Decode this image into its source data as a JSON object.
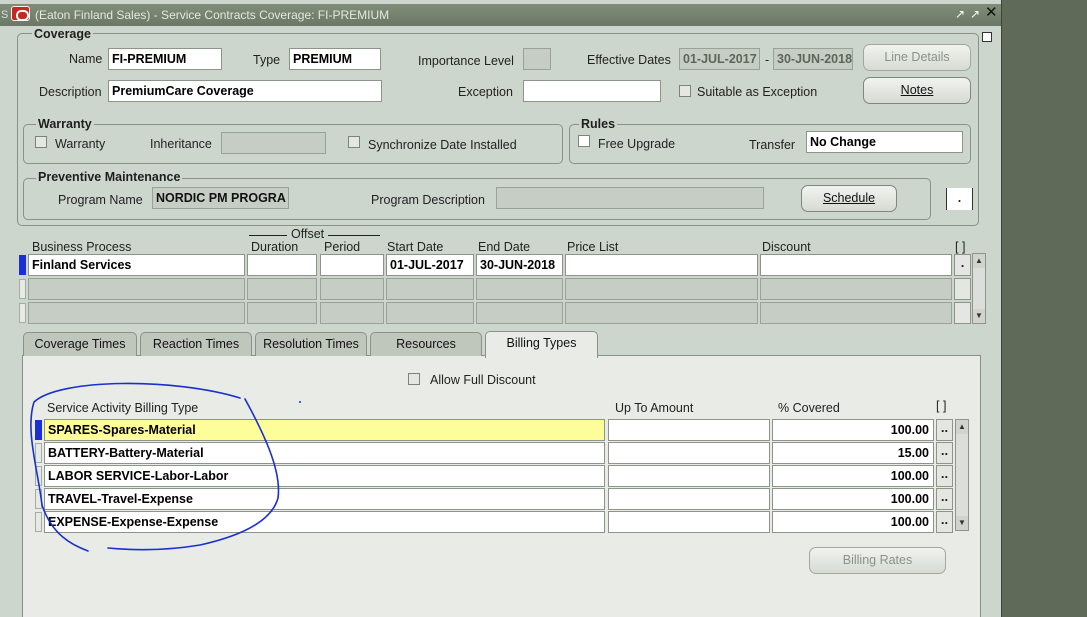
{
  "window": {
    "title": "(Eaton Finland Sales) - Service Contracts Coverage:  FI-PREMIUM",
    "left_edge_char": "S",
    "controls": [
      "↗",
      "↗",
      "✕"
    ]
  },
  "coverage": {
    "title": "Coverage",
    "name_label": "Name",
    "name_value": "FI-PREMIUM",
    "type_label": "Type",
    "type_value": "PREMIUM",
    "importance_label": "Importance Level",
    "importance_value": "",
    "effective_label": "Effective Dates",
    "effective_start": "01-JUL-2017",
    "effective_sep": "-",
    "effective_end": "30-JUN-2018",
    "line_details_label": "Line Details",
    "description_label": "Description",
    "description_value": "PremiumCare Coverage",
    "exception_label": "Exception",
    "exception_value": "",
    "suitable_label": "Suitable as Exception",
    "notes_label": "Notes"
  },
  "warranty": {
    "title": "Warranty",
    "warranty_label": "Warranty",
    "inheritance_label": "Inheritance",
    "inheritance_value": "",
    "sync_label": "Synchronize Date Installed"
  },
  "rules": {
    "title": "Rules",
    "free_upgrade_label": "Free Upgrade",
    "transfer_label": "Transfer",
    "transfer_value": "No Change"
  },
  "pm": {
    "title": "Preventive Maintenance",
    "program_name_label": "Program Name",
    "program_name_value": "NORDIC PM PROGRA",
    "program_desc_label": "Program Description",
    "program_desc_value": "",
    "schedule_label": "Schedule",
    "dot_label": "."
  },
  "process_table": {
    "offset_label": "Offset",
    "headers": {
      "business_process": "Business Process",
      "duration": "Duration",
      "period": "Period",
      "start_date": "Start Date",
      "end_date": "End Date",
      "price_list": "Price List",
      "discount": "Discount",
      "folder": "[ ]"
    },
    "rows": [
      {
        "business_process": "Finland Services",
        "duration": "",
        "period": "",
        "start_date": "01-JUL-2017",
        "end_date": "30-JUN-2018",
        "price_list": "",
        "discount": "",
        "dot": "."
      },
      {
        "business_process": "",
        "duration": "",
        "period": "",
        "start_date": "",
        "end_date": "",
        "price_list": "",
        "discount": "",
        "dot": ""
      },
      {
        "business_process": "",
        "duration": "",
        "period": "",
        "start_date": "",
        "end_date": "",
        "price_list": "",
        "discount": "",
        "dot": ""
      }
    ]
  },
  "tabs": [
    {
      "label": "Coverage Times"
    },
    {
      "label": "Reaction Times"
    },
    {
      "label": "Resolution Times"
    },
    {
      "label": "Resources"
    },
    {
      "label": "Billing Types"
    }
  ],
  "billing": {
    "allow_full_discount_label": "Allow Full Discount",
    "headers": {
      "billing_type": "Service Activity Billing Type",
      "up_to_amount": "Up To Amount",
      "pct_covered": "% Covered",
      "folder": "[ ]"
    },
    "rows": [
      {
        "billing_type": "SPARES-Spares-Material",
        "up_to_amount": "",
        "pct_covered": "100.00",
        "dots": ".."
      },
      {
        "billing_type": "BATTERY-Battery-Material",
        "up_to_amount": "",
        "pct_covered": "15.00",
        "dots": ".."
      },
      {
        "billing_type": "LABOR SERVICE-Labor-Labor",
        "up_to_amount": "",
        "pct_covered": "100.00",
        "dots": ".."
      },
      {
        "billing_type": "TRAVEL-Travel-Expense",
        "up_to_amount": "",
        "pct_covered": "100.00",
        "dots": ".."
      },
      {
        "billing_type": "EXPENSE-Expense-Expense",
        "up_to_amount": "",
        "pct_covered": "100.00",
        "dots": ".."
      }
    ],
    "billing_rates_label": "Billing Rates"
  },
  "colors": {
    "window_bg": "#cdd6cc",
    "desktop_bg": "#5f6b58",
    "active_row": "#fdfd9a",
    "record_indicator": "#1a2fd6",
    "annotation": "#1b2fd0"
  }
}
